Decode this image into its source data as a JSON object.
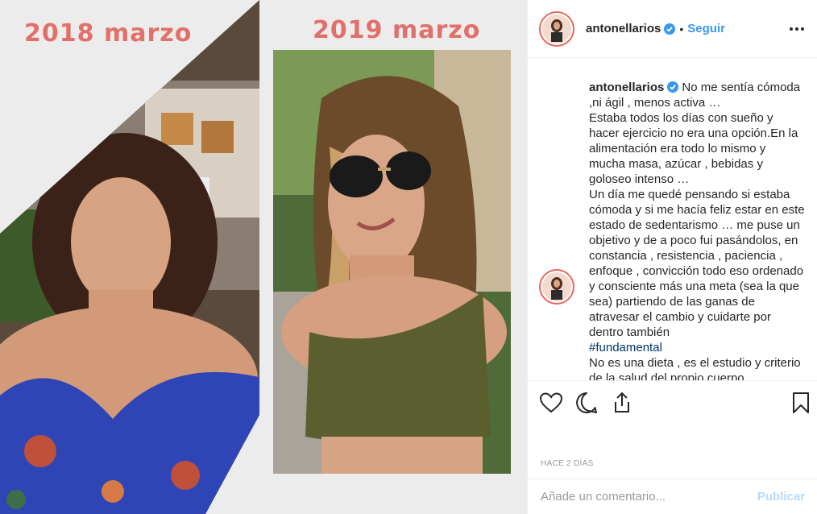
{
  "media": {
    "left_label": "2018 marzo",
    "right_label": "2019 marzo"
  },
  "header": {
    "username": "antonellarios",
    "separator": "•",
    "follow_label": "Seguir"
  },
  "caption": {
    "username": "antonellarios",
    "p1": "No me sentía cómoda ,ni ágil , menos activa …",
    "p2": "Estaba todos los días con sueño y hacer ejercicio no era una opción.En la alimentación era todo lo mismo y mucha masa, azúcar , bebidas y goloseo intenso …",
    "p3": "Un día me quedé pensando si estaba cómoda y si me hacía feliz estar en este estado de sedentarismo … me puse un objetivo y de a poco fui pasándolos, en constancia , resistencia , paciencia , enfoque , convicción todo eso ordenado y consciente más una meta (sea la que sea) partiendo de las ganas de atravesar el cambio y cuidarte por dentro también",
    "hashtag": "#fundamental",
    "p4": "No es una dieta , es el estudio y criterio de la salud del propio cuerpo"
  },
  "meta": {
    "time_ago": "HACE 2 DÍAS"
  },
  "comment": {
    "placeholder": "Añade un comentario...",
    "publish_label": "Publicar"
  },
  "colors": {
    "accent": "#3897f0",
    "label_pink": "#e2706a",
    "hashtag": "#003569"
  }
}
